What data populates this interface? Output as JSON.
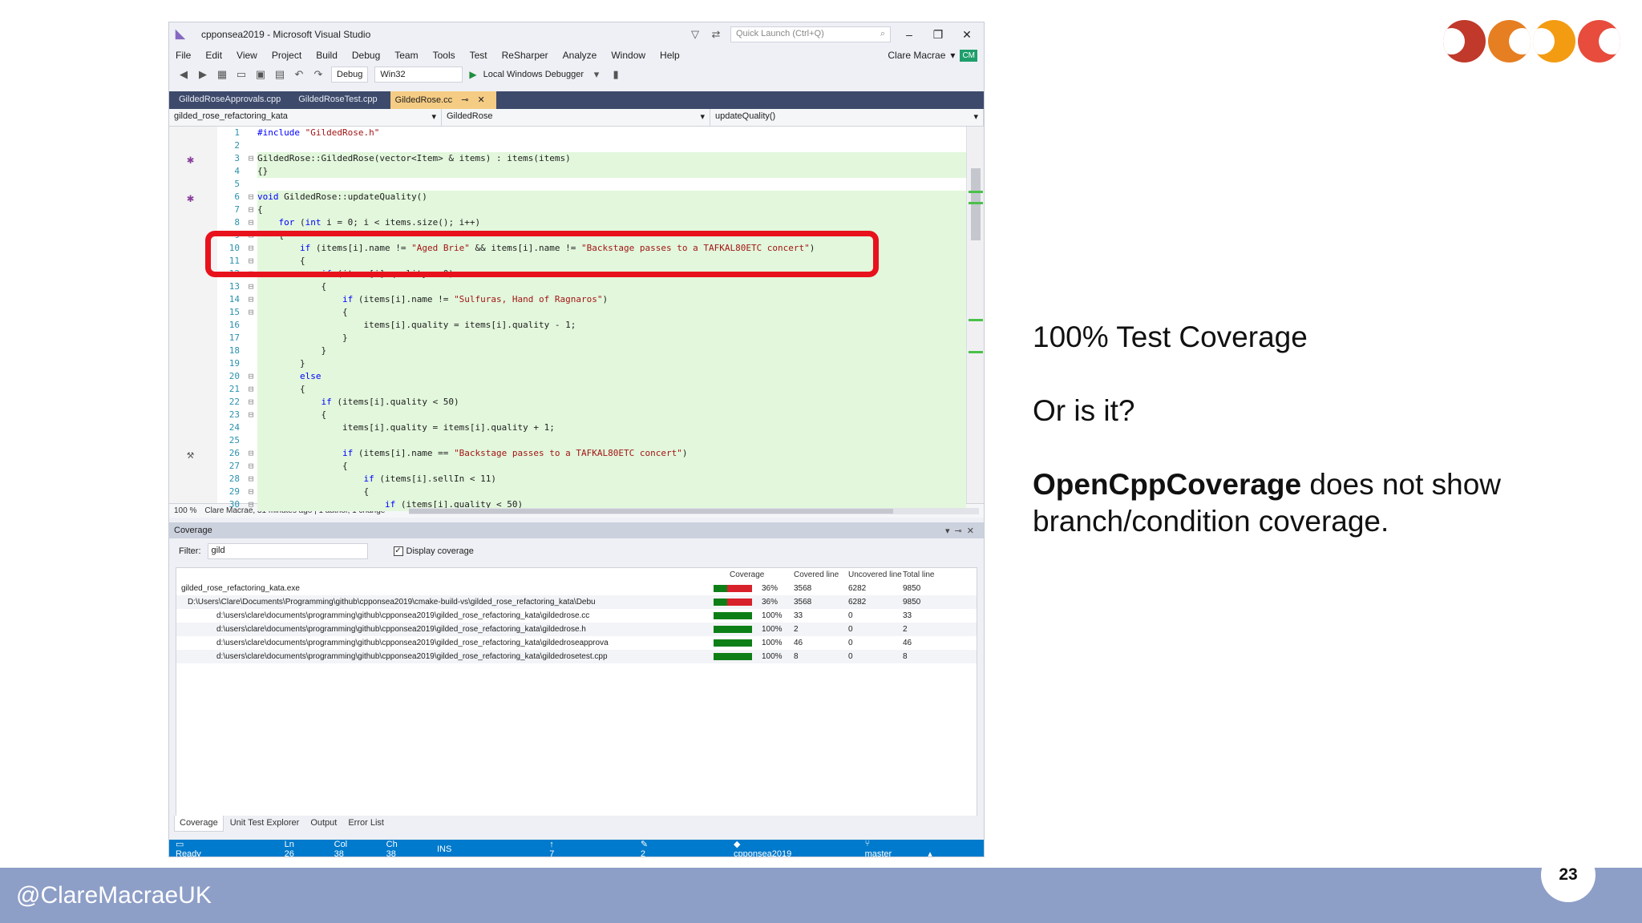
{
  "vs": {
    "title": "cpponsea2019 - Microsoft Visual Studio",
    "quick_launch": "Quick Launch (Ctrl+Q)",
    "menu": [
      "File",
      "Edit",
      "View",
      "Project",
      "Build",
      "Debug",
      "Team",
      "Tools",
      "Test",
      "ReSharper",
      "Analyze",
      "Window",
      "Help"
    ],
    "user": "Clare Macrae",
    "user_initials": "CM",
    "toolbar": {
      "config": "Debug",
      "platform": "Win32",
      "debugger": "Local Windows Debugger"
    },
    "doc_tabs": [
      "GildedRoseApprovals.cpp",
      "GildedRoseTest.cpp",
      "GildedRose.cc"
    ],
    "nav": {
      "project": "gilded_rose_refactoring_kata",
      "class": "GildedRose",
      "member": "updateQuality()"
    },
    "code_lines": [
      {
        "n": "1",
        "text": "#include \"GildedRose.h\"",
        "cov": false
      },
      {
        "n": "2",
        "text": "",
        "cov": false
      },
      {
        "n": "3",
        "text": "GildedRose::GildedRose(vector<Item> & items) : items(items)",
        "cov": true
      },
      {
        "n": "4",
        "text": "{}",
        "cov": true
      },
      {
        "n": "5",
        "text": "",
        "cov": false
      },
      {
        "n": "6",
        "text": "void GildedRose::updateQuality()",
        "cov": true
      },
      {
        "n": "7",
        "text": "{",
        "cov": true
      },
      {
        "n": "8",
        "text": "    for (int i = 0; i < items.size(); i++)",
        "cov": true
      },
      {
        "n": "9",
        "text": "    {",
        "cov": true
      },
      {
        "n": "10",
        "text": "        if (items[i].name != \"Aged Brie\" && items[i].name != \"Backstage passes to a TAFKAL80ETC concert\")",
        "cov": true
      },
      {
        "n": "11",
        "text": "        {",
        "cov": true
      },
      {
        "n": "12",
        "text": "            if (items[i].quality > 0)",
        "cov": true
      },
      {
        "n": "13",
        "text": "            {",
        "cov": true
      },
      {
        "n": "14",
        "text": "                if (items[i].name != \"Sulfuras, Hand of Ragnaros\")",
        "cov": true
      },
      {
        "n": "15",
        "text": "                {",
        "cov": true
      },
      {
        "n": "16",
        "text": "                    items[i].quality = items[i].quality - 1;",
        "cov": true
      },
      {
        "n": "17",
        "text": "                }",
        "cov": true
      },
      {
        "n": "18",
        "text": "            }",
        "cov": true
      },
      {
        "n": "19",
        "text": "        }",
        "cov": true
      },
      {
        "n": "20",
        "text": "        else",
        "cov": true
      },
      {
        "n": "21",
        "text": "        {",
        "cov": true
      },
      {
        "n": "22",
        "text": "            if (items[i].quality < 50)",
        "cov": true
      },
      {
        "n": "23",
        "text": "            {",
        "cov": true
      },
      {
        "n": "24",
        "text": "                items[i].quality = items[i].quality + 1;",
        "cov": true
      },
      {
        "n": "25",
        "text": "",
        "cov": true
      },
      {
        "n": "26",
        "text": "                if (items[i].name == \"Backstage passes to a TAFKAL80ETC concert\")",
        "cov": true
      },
      {
        "n": "27",
        "text": "                {",
        "cov": true
      },
      {
        "n": "28",
        "text": "                    if (items[i].sellIn < 11)",
        "cov": true
      },
      {
        "n": "29",
        "text": "                    {",
        "cov": true
      },
      {
        "n": "30",
        "text": "                        if (items[i].quality < 50)",
        "cov": true
      }
    ],
    "editor_status": {
      "zoom": "100 %",
      "blame": "Clare Macrae, 31 minutes ago | 1 author, 1 change"
    },
    "coverage_pane": {
      "title": "Coverage",
      "filter_label": "Filter:",
      "filter_value": "gild",
      "display_coverage": "Display coverage",
      "columns": [
        "Coverage",
        "Covered line",
        "Uncovered line",
        "Total line"
      ],
      "rows": [
        {
          "name": "gilded_rose_refactoring_kata.exe",
          "pct": "36%",
          "fill": 0.36,
          "covered": "3568",
          "uncovered": "6282",
          "total": "9850"
        },
        {
          "name": "D:\\Users\\Clare\\Documents\\Programming\\github\\cpponsea2019\\cmake-build-vs\\gilded_rose_refactoring_kata\\Debu",
          "pct": "36%",
          "fill": 0.36,
          "covered": "3568",
          "uncovered": "6282",
          "total": "9850"
        },
        {
          "name": "d:\\users\\clare\\documents\\programming\\github\\cpponsea2019\\gilded_rose_refactoring_kata\\gildedrose.cc",
          "pct": "100%",
          "fill": 1,
          "covered": "33",
          "uncovered": "0",
          "total": "33"
        },
        {
          "name": "d:\\users\\clare\\documents\\programming\\github\\cpponsea2019\\gilded_rose_refactoring_kata\\gildedrose.h",
          "pct": "100%",
          "fill": 1,
          "covered": "2",
          "uncovered": "0",
          "total": "2"
        },
        {
          "name": "d:\\users\\clare\\documents\\programming\\github\\cpponsea2019\\gilded_rose_refactoring_kata\\gildedroseapprova",
          "pct": "100%",
          "fill": 1,
          "covered": "46",
          "uncovered": "0",
          "total": "46"
        },
        {
          "name": "d:\\users\\clare\\documents\\programming\\github\\cpponsea2019\\gilded_rose_refactoring_kata\\gildedrosetest.cpp",
          "pct": "100%",
          "fill": 1,
          "covered": "8",
          "uncovered": "0",
          "total": "8"
        }
      ]
    },
    "pane_tabs": [
      "Coverage",
      "Unit Test Explorer",
      "Output",
      "Error List"
    ],
    "status": {
      "ready": "Ready",
      "ln": "Ln 26",
      "col": "Col 38",
      "ch": "Ch 38",
      "ins": "INS",
      "up": "7",
      "edits": "2",
      "repo": "cpponsea2019",
      "branch": "master"
    }
  },
  "slide": {
    "line1": "100% Test Coverage",
    "line2": "Or is it?",
    "line3_bold": "OpenCppCoverage",
    "line3_rest": " does not show branch/condition coverage.",
    "footer_handle": "@ClareMacraeUK",
    "page_number": "23",
    "logo_colors": [
      "#c0392b",
      "#e67e22",
      "#f39c12",
      "#e74c3c"
    ]
  }
}
